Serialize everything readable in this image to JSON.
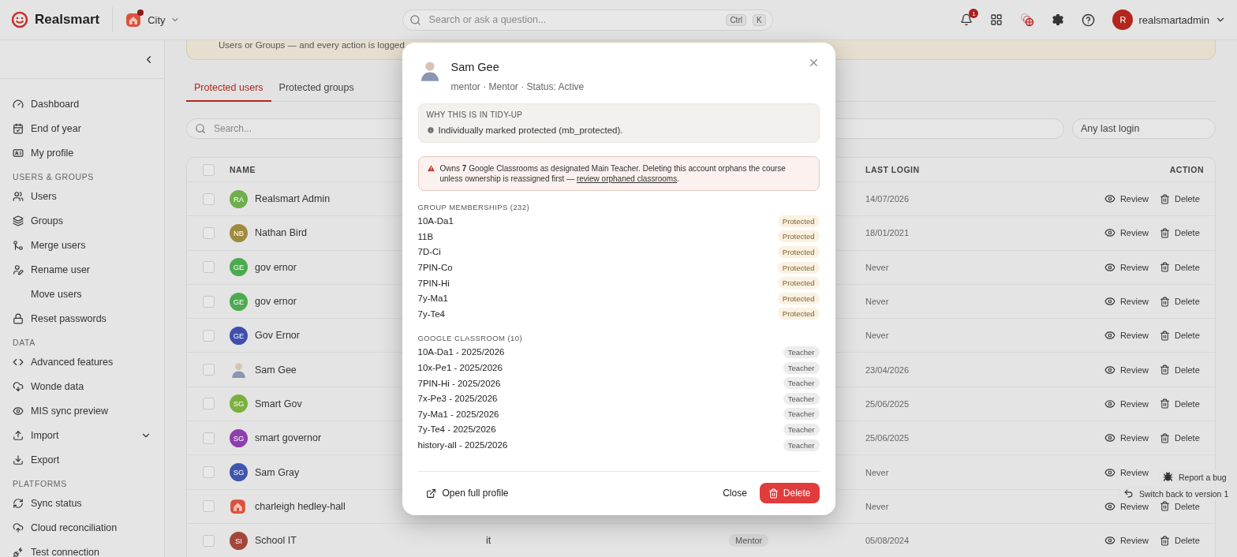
{
  "topbar": {
    "brand": "Realsmart",
    "school": "City",
    "search_placeholder": "Search or ask a question...",
    "shortcut": [
      "Ctrl",
      "K"
    ],
    "notification_count": "1",
    "user_initial": "R",
    "username": "realsmartadmin"
  },
  "sidebar": {
    "sections": [
      {
        "items": [
          {
            "label": "Dashboard",
            "kind": "link"
          },
          {
            "label": "End of year",
            "kind": "link"
          },
          {
            "label": "My profile",
            "kind": "link"
          }
        ]
      },
      {
        "heading": "USERS & GROUPS",
        "items": [
          {
            "label": "Users",
            "kind": "link"
          },
          {
            "label": "Groups",
            "kind": "link"
          },
          {
            "label": "Merge users",
            "kind": "link"
          },
          {
            "label": "Rename user",
            "kind": "link"
          },
          {
            "label": "Move users",
            "kind": "link"
          },
          {
            "label": "Reset passwords",
            "kind": "link"
          }
        ]
      },
      {
        "heading": "DATA",
        "items": [
          {
            "label": "Advanced features",
            "kind": "link"
          },
          {
            "label": "Wonde data",
            "kind": "link"
          },
          {
            "label": "MIS sync preview",
            "kind": "link"
          },
          {
            "label": "Import",
            "kind": "group",
            "expanded": false
          },
          {
            "label": "Export",
            "kind": "link"
          }
        ]
      },
      {
        "heading": "PLATFORMS",
        "items": [
          {
            "label": "Sync status",
            "kind": "link"
          },
          {
            "label": "Cloud reconciliation",
            "kind": "link"
          },
          {
            "label": "Test connection",
            "kind": "link"
          }
        ]
      }
    ]
  },
  "banner": {
    "text": "Users or Groups — and every action is logged."
  },
  "tabs": [
    {
      "label": "Protected users",
      "selected": true
    },
    {
      "label": "Protected groups",
      "selected": false
    }
  ],
  "filters": {
    "search_placeholder": "Search...",
    "last_login": "Any last login"
  },
  "table": {
    "columns": [
      "NAME",
      "LAST LOGIN",
      "ACTION"
    ],
    "all_checked": false,
    "rows": [
      {
        "checked": false,
        "avatar": {
          "kind": "initials",
          "text": "RA",
          "color": "#6fae4a"
        },
        "name": "Realsmart Admin",
        "last_login": "14/07/2026",
        "actions": [
          "Review",
          "Delete"
        ]
      },
      {
        "checked": false,
        "avatar": {
          "kind": "initials",
          "text": "NB",
          "color": "#a08a3e"
        },
        "name": "Nathan Bird",
        "last_login": "18/01/2021",
        "actions": [
          "Review",
          "Delete"
        ]
      },
      {
        "checked": false,
        "avatar": {
          "kind": "initials",
          "text": "GE",
          "color": "#4caa50"
        },
        "name": "gov ernor",
        "last_login": "Never",
        "actions": [
          "Review",
          "Delete"
        ]
      },
      {
        "checked": false,
        "avatar": {
          "kind": "initials",
          "text": "GE",
          "color": "#4caa50"
        },
        "name": "gov ernor",
        "last_login": "Never",
        "actions": [
          "Review",
          "Delete"
        ]
      },
      {
        "checked": false,
        "avatar": {
          "kind": "initials",
          "text": "GE",
          "color": "#3f4fae"
        },
        "name": "Gov Ernor",
        "last_login": "Never",
        "actions": [
          "Review",
          "Delete"
        ]
      },
      {
        "checked": false,
        "avatar": {
          "kind": "photo"
        },
        "name": "Sam Gee",
        "last_login": "23/04/2026",
        "actions": [
          "Review",
          "Delete"
        ]
      },
      {
        "checked": false,
        "avatar": {
          "kind": "initials",
          "text": "SG",
          "color": "#7bb03f"
        },
        "name": "Smart Gov",
        "last_login": "25/06/2025",
        "actions": [
          "Review",
          "Delete"
        ]
      },
      {
        "checked": false,
        "avatar": {
          "kind": "initials",
          "text": "SG",
          "color": "#8e3fae"
        },
        "name": "smart governor",
        "last_login": "25/06/2025",
        "actions": [
          "Review",
          "Delete"
        ]
      },
      {
        "checked": false,
        "avatar": {
          "kind": "initials",
          "text": "SG",
          "color": "#3f55ae"
        },
        "name": "Sam Gray",
        "last_login": "Never",
        "actions": [
          "Review"
        ]
      },
      {
        "checked": false,
        "avatar": {
          "kind": "logo"
        },
        "name": "charleigh hedley-hall",
        "last_login": "Never",
        "actions": [
          "Review",
          "Delete"
        ]
      },
      {
        "checked": false,
        "avatar": {
          "kind": "initials",
          "text": "SI",
          "color": "#a3473b"
        },
        "name": "School IT",
        "column_2": "it",
        "column_3": "Mentor",
        "last_login": "05/08/2024",
        "actions": [
          "Review",
          "Delete"
        ]
      }
    ]
  },
  "modal": {
    "name": "Sam Gee",
    "subtitle": "mentor · Mentor · Status: Active",
    "why": {
      "heading": "WHY THIS IS IN TIDY-UP",
      "reason": "Individually marked protected (mb_protected)."
    },
    "warning": {
      "text": "Owns **7** Google Classrooms as designated Main Teacher. Deleting this account orphans the course unless ownership is reassigned first — ",
      "link": "review orphaned classrooms",
      "end": "."
    },
    "sections": [
      {
        "heading": "GROUP MEMBERSHIPS (232)",
        "items": [
          {
            "name": "10A-Da1",
            "tag": "Protected",
            "kind": "protected"
          },
          {
            "name": "11B",
            "tag": "Protected",
            "kind": "protected"
          },
          {
            "name": "7D-Ci",
            "tag": "Protected",
            "kind": "protected"
          },
          {
            "name": "7PIN-Co",
            "tag": "Protected",
            "kind": "protected"
          },
          {
            "name": "7PIN-Hi",
            "tag": "Protected",
            "kind": "protected"
          },
          {
            "name": "7y-Ma1",
            "tag": "Protected",
            "kind": "protected"
          },
          {
            "name": "7y-Te4",
            "tag": "Protected",
            "kind": "protected"
          }
        ]
      },
      {
        "heading": "GOOGLE CLASSROOM (10)",
        "items": [
          {
            "name": "10A-Da1 - 2025/2026",
            "tag": "Teacher",
            "kind": "teacher"
          },
          {
            "name": "10x-Pe1 - 2025/2026",
            "tag": "Teacher",
            "kind": "teacher"
          },
          {
            "name": "7PIN-Hi - 2025/2026",
            "tag": "Teacher",
            "kind": "teacher"
          },
          {
            "name": "7x-Pe3 - 2025/2026",
            "tag": "Teacher",
            "kind": "teacher"
          },
          {
            "name": "7y-Ma1 - 2025/2026",
            "tag": "Teacher",
            "kind": "teacher"
          },
          {
            "name": "7y-Te4 - 2025/2026",
            "tag": "Teacher",
            "kind": "teacher"
          },
          {
            "name": "history-all - 2025/2026",
            "tag": "Teacher",
            "kind": "teacher"
          }
        ]
      }
    ],
    "footer": {
      "open_profile": "Open full profile",
      "close": "Close",
      "delete": "Delete"
    }
  },
  "floating": {
    "report_bug": "Report a bug",
    "switch_back": "Switch back to version 1"
  }
}
